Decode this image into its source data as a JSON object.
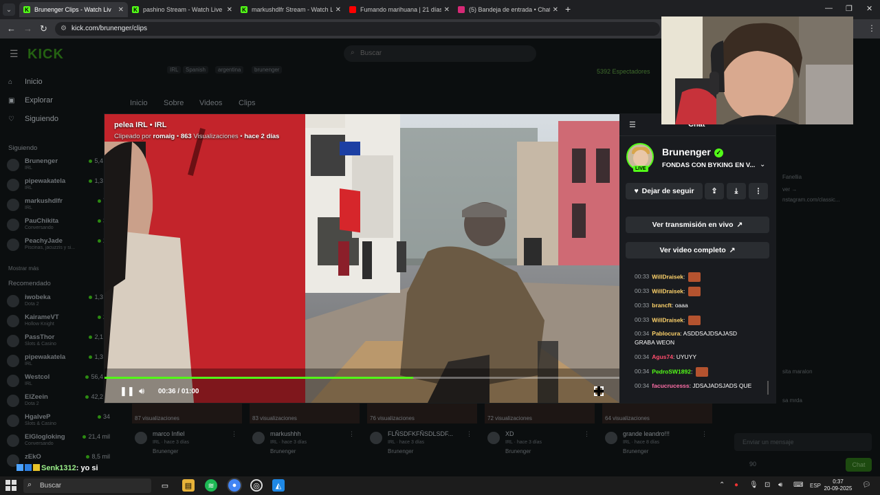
{
  "browser": {
    "tabs": [
      {
        "title": "Brunenger Clips - Watch Liv",
        "active": true,
        "favicon": "kick-icon",
        "color": "#53fc18"
      },
      {
        "title": "pashino Stream - Watch Live o",
        "favicon": "kick-icon",
        "color": "#53fc18"
      },
      {
        "title": "markushdlfr Stream - Watch Li",
        "favicon": "kick-icon",
        "color": "#53fc18"
      },
      {
        "title": "Fumando marihuana | 21 días",
        "favicon": "youtube-icon",
        "color": "#ff0000"
      },
      {
        "title": "(5) Bandeja de entrada • Chats",
        "favicon": "instagram-icon",
        "color": "#d62976"
      }
    ],
    "url": "kick.com/brunenger/clips"
  },
  "kick": {
    "logo": "KICK",
    "search_placeholder": "Buscar",
    "nav": [
      "Inicio",
      "Explorar",
      "Siguiendo"
    ],
    "following_header": "Siguiendo",
    "following": [
      {
        "name": "Brunenger",
        "sub": "IRL",
        "viewers": "5,4 m"
      },
      {
        "name": "pipewakatela",
        "sub": "IRL",
        "viewers": "1,3 m"
      },
      {
        "name": "markushdlfr",
        "sub": "IRL",
        "viewers": "77"
      },
      {
        "name": "PauChikita",
        "sub": "Conversando",
        "viewers": "38"
      },
      {
        "name": "PeachyJade",
        "sub": "Piscinas, jacuzzis y si...",
        "viewers": "27"
      }
    ],
    "show_more": "Mostrar más",
    "recommended_header": "Recomendado",
    "recommended": [
      {
        "name": "iwobeka",
        "sub": "Dota 2",
        "viewers": "1,3 m"
      },
      {
        "name": "KairameVT",
        "sub": "Hollow Knight",
        "viewers": "26"
      },
      {
        "name": "PassThor",
        "sub": "Slots & Casino",
        "viewers": "2,1 m"
      },
      {
        "name": "pipewakatela",
        "sub": "IRL",
        "viewers": "1,3 m"
      },
      {
        "name": "Westcol",
        "sub": "IRL",
        "viewers": "56,4 m"
      },
      {
        "name": "ElZeein",
        "sub": "Dota 2",
        "viewers": "42,2 m"
      },
      {
        "name": "HgalveP",
        "sub": "Slots & Casino",
        "viewers": "34"
      },
      {
        "name": "ElGlogloking",
        "sub": "Conversando",
        "viewers": "21,4 mil"
      },
      {
        "name": "zEkO",
        "sub": "",
        "viewers": "8,5 mil"
      }
    ],
    "tags": [
      "IRL",
      "Spanish",
      "argentina",
      "brunenger"
    ],
    "spectators": "5392 Espectadores",
    "profile_tabs": [
      "Inicio",
      "Sobre",
      "Videos",
      "Clips"
    ],
    "clips": [
      {
        "views": "87 visualizaciones",
        "title": "marco Infiel",
        "sub": "IRL · hace 3 días",
        "channel": "Brunenger"
      },
      {
        "views": "83 visualizaciones",
        "title": "markushhh",
        "sub": "IRL · hace 3 días",
        "channel": "Brunenger"
      },
      {
        "views": "76 visualizaciones",
        "title": "FLÑSDFKFÑSDLSDF...",
        "sub": "IRL · hace 3 días",
        "channel": "Brunenger"
      },
      {
        "views": "72 visualizaciones",
        "title": "XD",
        "sub": "IRL · hace 3 días",
        "channel": "Brunenger"
      },
      {
        "views": "64 visualizaciones",
        "title": "grande leandro!!!",
        "sub": "IRL · hace 8 días",
        "channel": "Brunenger"
      }
    ],
    "bg_chat": [
      "Fanellia",
      "ver →",
      "nstagram.com/classic...",
      "sita maralon",
      "sa mrda"
    ],
    "chat_input_placeholder": "Enviar un mensaje",
    "points": "90",
    "chat_button": "Chat"
  },
  "clip": {
    "title": "pelea IRL",
    "category": "IRL",
    "clipped_by_label": "Clipeado por",
    "clipper": "romaig",
    "views_num": "863",
    "views_label": "Visualizaciones",
    "age": "hace 2 días",
    "current_time": "00:36",
    "duration": "01:00",
    "progress": 0.6
  },
  "panel": {
    "header": "Chat",
    "streamer": "Brunenger",
    "live_badge": "LIVE",
    "stream_title": "FONDAS CON BYKING EN V...",
    "follow_label": "Dejar de seguir",
    "watch_live": "Ver transmisión en vivo",
    "watch_full": "Ver video completo",
    "chat": [
      {
        "time": "00:33",
        "user": "WillDraisek",
        "color": "#ffd36b",
        "text": "",
        "emote": true
      },
      {
        "time": "00:33",
        "user": "WillDraisek",
        "color": "#ffd36b",
        "text": "",
        "emote": true
      },
      {
        "time": "00:33",
        "user": "brancft",
        "color": "#ffd36b",
        "text": "oaaa",
        "emote": false
      },
      {
        "time": "00:33",
        "user": "WillDraisek",
        "color": "#ffd36b",
        "text": "",
        "emote": true
      },
      {
        "time": "00:34",
        "user": "Pablocura",
        "color": "#ffd36b",
        "text": "ASDDSAJDSAJASD GRABA WEON",
        "emote": false
      },
      {
        "time": "00:34",
        "user": "Agus74",
        "color": "#ff4d6d",
        "text": "UYUYY",
        "emote": false
      },
      {
        "time": "00:34",
        "user": "PedroSW1892",
        "color": "#53fc18",
        "text": "",
        "emote": true
      },
      {
        "time": "00:34",
        "user": "facucrucesss",
        "color": "#ff6fa8",
        "text": "JDSAJADSJADS QUE",
        "emote": false
      }
    ]
  },
  "overlay_chat": {
    "user": "Senk1312",
    "text": ": yo si"
  },
  "taskbar": {
    "search": "Buscar",
    "lang": "ESP",
    "time": "0:37",
    "date": "20-09-2025"
  }
}
